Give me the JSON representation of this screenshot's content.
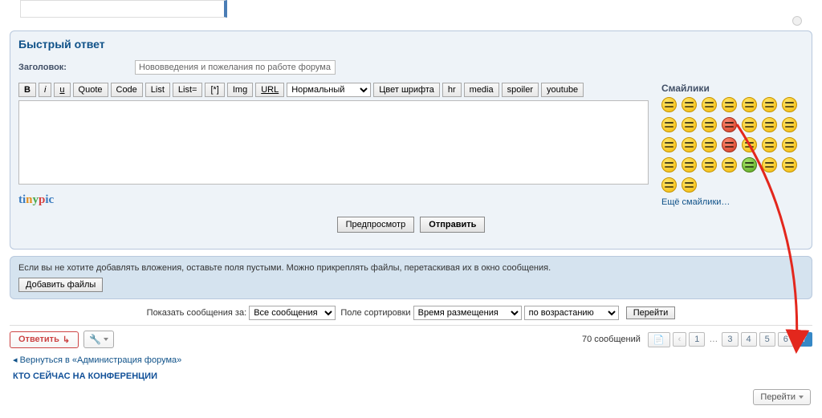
{
  "quick_reply_title": "Быстрый ответ",
  "subject_label": "Заголовок:",
  "subject_value": "Нововведения и пожелания по работе форума",
  "toolbar": {
    "bold": "B",
    "italic": "i",
    "underline": "u",
    "quote": "Quote",
    "code": "Code",
    "list": "List",
    "list_eq": "List=",
    "list_item": "[*]",
    "img": "Img",
    "url": "URL",
    "font_size": "Нормальный",
    "font_color": "Цвет шрифта",
    "hr": "hr",
    "media": "media",
    "spoiler": "spoiler",
    "youtube": "youtube"
  },
  "tinypic": "tinypic",
  "smilies_title": "Смайлики",
  "more_smilies": "Ещё смайлики…",
  "preview_btn": "Предпросмотр",
  "submit_btn": "Отправить",
  "attach_text": "Если вы не хотите добавлять вложения, оставьте поля пустыми. Можно прикреплять файлы, перетаскивая их в окно сообщения.",
  "attach_btn": "Добавить файлы",
  "display_options": {
    "show_label": "Показать сообщения за:",
    "show_sel": "Все сообщения",
    "sort_label": "Поле сортировки",
    "sort_sel": "Время размещения",
    "dir_sel": "по возрастанию",
    "go": "Перейти"
  },
  "reply_btn": "Ответить",
  "post_count": "70 сообщений",
  "pages": [
    "1",
    "3",
    "4",
    "5",
    "6",
    "7"
  ],
  "active_page": "7",
  "return_link": "Вернуться в «Администрация форума»",
  "jump_btn": "Перейти",
  "who_online": "КТО СЕЙЧАС НА КОНФЕРЕНЦИИ"
}
